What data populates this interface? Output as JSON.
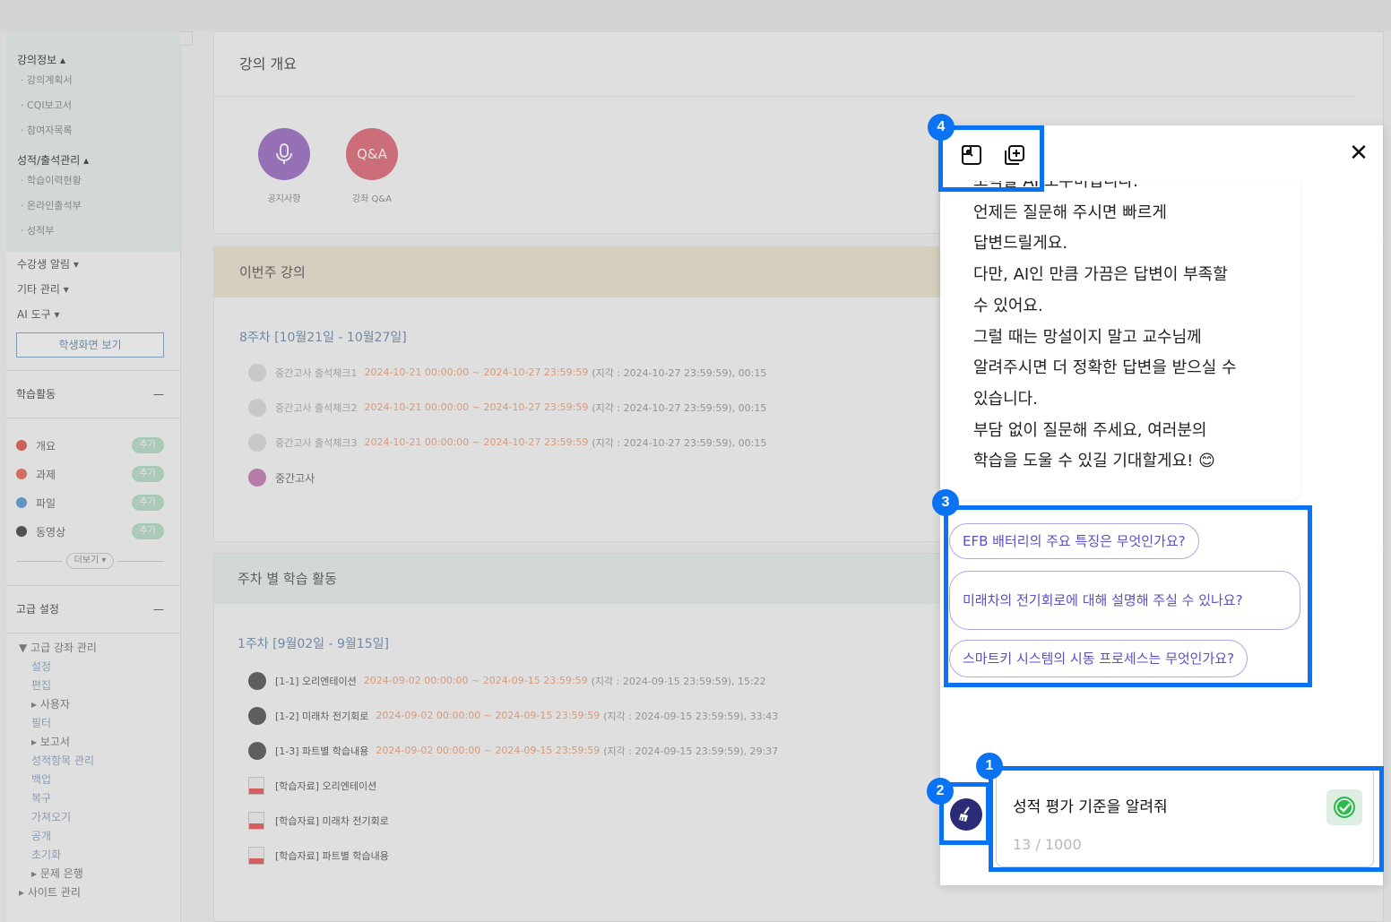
{
  "sidebar": {
    "info_head": "강의정보 ▴",
    "info_items": [
      "· 강의계획서",
      "· CQI보고서",
      "· 참여자목록"
    ],
    "grade_head": "성적/출석관리 ▴",
    "grade_items": [
      "· 학습이력현황",
      "· 온라인출석부",
      "· 성적부"
    ],
    "alarm": "수강생 알림 ▾",
    "etc": "기타 관리 ▾",
    "ai": "AI 도구 ▾",
    "student_view": "학생화면 보기",
    "activity_title": "학습활동",
    "activity_collapse": "—",
    "activities": [
      {
        "label": "개요",
        "add": "추가",
        "color": "#e0584f"
      },
      {
        "label": "과제",
        "add": "추가",
        "color": "#e86a55"
      },
      {
        "label": "파일",
        "add": "추가",
        "color": "#5a9bd4"
      },
      {
        "label": "동영상",
        "add": "추가",
        "color": "#444444"
      }
    ],
    "more": "더보기 ▾",
    "advanced_title": "고급 설정",
    "advanced_collapse": "—",
    "advanced_items": [
      "▼ 고급 강좌 관리",
      "설정",
      "편집",
      "▸ 사용자",
      "필터",
      "▸ 보고서",
      "성적항목 관리",
      "백업",
      "복구",
      "가져오기",
      "공개",
      "초기화",
      "▸ 문제 은행",
      "▸ 사이트 관리"
    ]
  },
  "main": {
    "overview_title": "강의 개요",
    "notice_label": "공지사항",
    "qa_icon": "Q&A",
    "qa_label": "강좌 Q&A",
    "this_week_title": "이번주 강의",
    "week8": "8주차 [10월21일 - 10월27일]",
    "week8_items": [
      {
        "title": "중간고사 출석체크1",
        "date": "2024-10-21 00:00:00 ~ 2024-10-27 23:59:59",
        "meta": "(지각 : 2024-10-27 23:59:59), 00:15"
      },
      {
        "title": "중간고사 출석체크2",
        "date": "2024-10-21 00:00:00 ~ 2024-10-27 23:59:59",
        "meta": "(지각 : 2024-10-27 23:59:59), 00:15"
      },
      {
        "title": "중간고사 출석체크3",
        "date": "2024-10-21 00:00:00 ~ 2024-10-27 23:59:59",
        "meta": "(지각 : 2024-10-27 23:59:59), 00:15"
      }
    ],
    "exam": "중간고사",
    "weekly_title": "주차 별 학습 활동",
    "week1": "1주차 [9월02일 - 9월15일]",
    "week1_items": [
      {
        "title": "[1-1] 오리엔테이션",
        "date": "2024-09-02 00:00:00 ~ 2024-09-15 23:59:59",
        "meta": "(지각 : 2024-09-15 23:59:59), 15:22"
      },
      {
        "title": "[1-2] 미래차 전기회로",
        "date": "2024-09-02 00:00:00 ~ 2024-09-15 23:59:59",
        "meta": "(지각 : 2024-09-15 23:59:59), 33:43"
      },
      {
        "title": "[1-3] 파트별 학습내용",
        "date": "2024-09-02 00:00:00 ~ 2024-09-15 23:59:59",
        "meta": "(지각 : 2024-09-15 23:59:59), 29:37"
      }
    ],
    "files": [
      "[학습자료] 오리엔테이션",
      "[학습자료] 미래차 전기회로",
      "[학습자료] 파트별 학습내용"
    ]
  },
  "chat": {
    "close": "✕",
    "message": "조력할 AI 도우미입니다.\n언제든 질문해 주시면 빠르게\n답변드릴게요.\n다만, AI인 만큼 가끔은 답변이 부족할\n수 있어요.\n그럴 때는 망설이지 말고 교수님께\n알려주시면 더 정확한 답변을 받으실 수\n있습니다.\n부담 없이 질문해 주세요, 여러분의\n학습을 도울 수 있길 기대할게요! 😊",
    "suggestions": [
      "EFB 배터리의 주요 특징은 무엇인가요?",
      "미래차의 전기회로에 대해 설명해 주실 수 있나요?",
      "스마트키 시스템의 시동 프로세스는 무엇인가요?"
    ],
    "input_value": "성적 평가 기준을 알려줘",
    "counter": "13 / 1000"
  },
  "annotations": [
    "1",
    "2",
    "3",
    "4"
  ],
  "colors": {
    "highlight": "#0a73f4",
    "chip_text": "#5b4fc2",
    "send": "#2dbb4e",
    "clear_button": "#2b2b78"
  }
}
